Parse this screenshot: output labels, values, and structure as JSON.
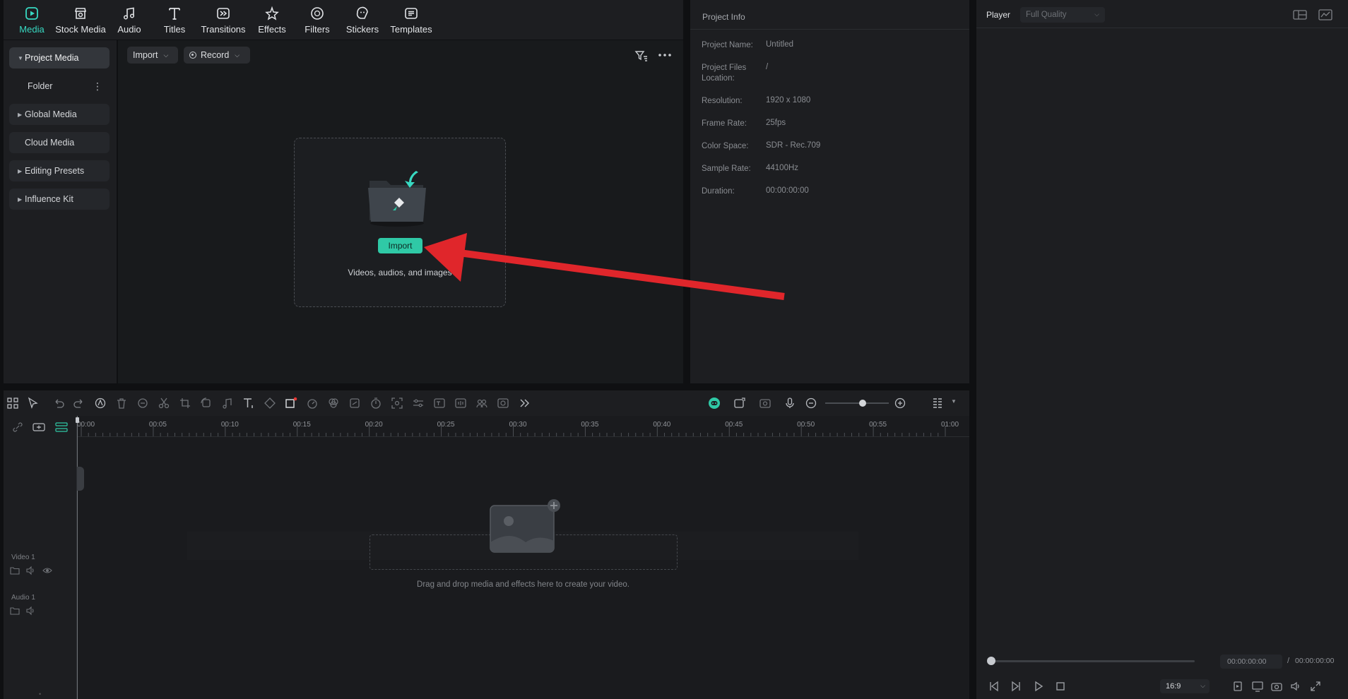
{
  "nav": {
    "items": [
      {
        "label": "Media",
        "icon": "media-icon",
        "active": true
      },
      {
        "label": "Stock Media",
        "icon": "stock-media-icon"
      },
      {
        "label": "Audio",
        "icon": "music-note-icon"
      },
      {
        "label": "Titles",
        "icon": "text-t-icon"
      },
      {
        "label": "Transitions",
        "icon": "transitions-icon"
      },
      {
        "label": "Effects",
        "icon": "effects-star-icon"
      },
      {
        "label": "Filters",
        "icon": "filters-icon"
      },
      {
        "label": "Stickers",
        "icon": "stickers-icon"
      },
      {
        "label": "Templates",
        "icon": "templates-icon"
      }
    ]
  },
  "sidebar": {
    "items": [
      {
        "label": "Project Media"
      },
      {
        "label": "Folder"
      },
      {
        "label": "Global Media"
      },
      {
        "label": "Cloud Media"
      },
      {
        "label": "Editing Presets"
      },
      {
        "label": "Influence Kit"
      }
    ]
  },
  "media": {
    "import_label": "Import",
    "record_label": "Record",
    "dropzone": {
      "button": "Import",
      "hint": "Videos, audios, and images"
    }
  },
  "project_info": {
    "title": "Project Info",
    "rows": [
      {
        "key": "Project Name:",
        "value": "Untitled"
      },
      {
        "key": "Project Files Location:",
        "value": "/"
      },
      {
        "key": "Resolution:",
        "value": "1920 x 1080"
      },
      {
        "key": "Frame Rate:",
        "value": "25fps"
      },
      {
        "key": "Color Space:",
        "value": "SDR - Rec.709"
      },
      {
        "key": "Sample Rate:",
        "value": "44100Hz"
      },
      {
        "key": "Duration:",
        "value": "00:00:00:00"
      }
    ]
  },
  "player": {
    "title": "Player",
    "quality": "Full Quality",
    "current_time": "00:00:00:00",
    "separator": "/",
    "total_time": "00:00:00:00",
    "aspect": "16:9"
  },
  "timeline": {
    "ticks": [
      "00:00",
      "00:05",
      "00:10",
      "00:15",
      "00:20",
      "00:25",
      "00:30",
      "00:35",
      "00:40",
      "00:45",
      "00:50",
      "00:55",
      "01:00"
    ],
    "tracks": {
      "video": "Video 1",
      "audio": "Audio 1"
    },
    "drop_hint": "Drag and drop media and effects here to create your video."
  },
  "colors": {
    "accent": "#38d9c2",
    "import_button": "#2fc9a6",
    "annotation_arrow": "#e0262b",
    "record_dot": "#e53935"
  }
}
